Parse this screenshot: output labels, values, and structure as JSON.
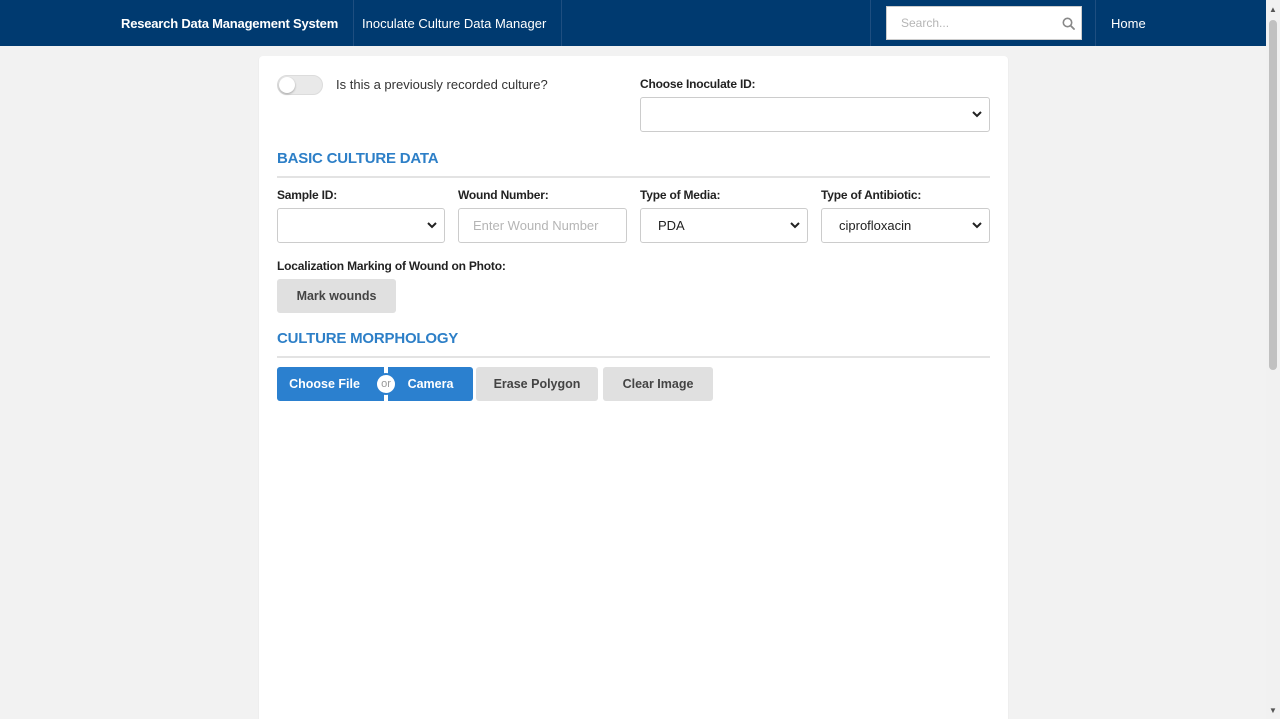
{
  "navbar": {
    "brand": "Research Data Management System",
    "link": "Inoculate Culture Data Manager",
    "search_placeholder": "Search...",
    "home": "Home"
  },
  "form": {
    "toggle_label": "Is this a previously recorded culture?",
    "toggle_on": false,
    "inoculate_label": "Choose Inoculate ID:",
    "inoculate_value": "",
    "basic_title": "BASIC CULTURE DATA",
    "sample_label": "Sample ID:",
    "sample_value": "",
    "wound_label": "Wound Number:",
    "wound_placeholder": "Enter Wound Number",
    "media_label": "Type of Media:",
    "media_value": "PDA",
    "antibiotic_label": "Type of Antibiotic:",
    "antibiotic_value": "ciprofloxacin",
    "localization_label": "Localization Marking of Wound on Photo:",
    "mark_button": "Mark wounds",
    "morphology_title": "CULTURE MORPHOLOGY",
    "choose_file": "Choose File",
    "or": "or",
    "camera": "Camera",
    "erase_polygon": "Erase Polygon",
    "clear_image": "Clear Image"
  },
  "colors": {
    "navbar": "#003a70",
    "accent": "#2b80cf",
    "section_title": "#2d7fc7"
  }
}
